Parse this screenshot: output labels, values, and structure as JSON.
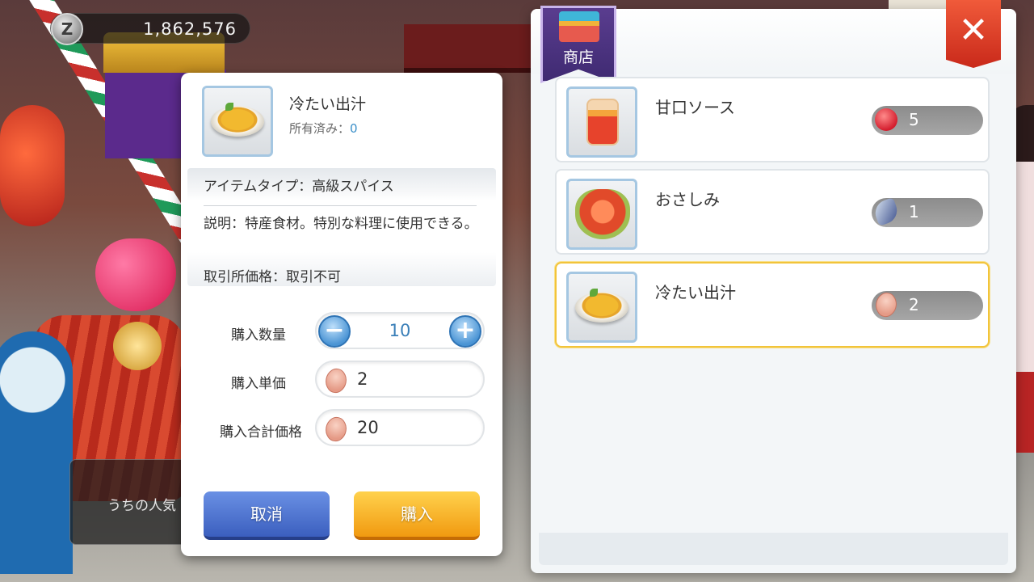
{
  "currency": {
    "icon_letter": "Z",
    "icon": "zeny-coin-icon",
    "amount": "1,862,576"
  },
  "chat": {
    "text": "うちの人気"
  },
  "dialog": {
    "item_name": "冷たい出汁",
    "owned_label": "所有済み：",
    "owned_count": "0",
    "item_type": "アイテムタイプ：高級スパイス",
    "description": "説明：特産食材。特別な料理に使用できる。",
    "exchange_price": "取引所価格：取引不可",
    "quantity_label": "購入数量",
    "quantity": "10",
    "minus_symbol": "−",
    "plus_symbol": "+",
    "unit_price_label": "購入単価",
    "unit_price": "2",
    "total_price_label": "購入合計価格",
    "total_price": "20",
    "price_icon": "meat-icon",
    "cancel_label": "取消",
    "buy_label": "購入"
  },
  "shop": {
    "banner_label": "商店",
    "close_symbol": "✕",
    "items": [
      {
        "name": "甘口ソース",
        "cost": "5",
        "cost_icon": "apple-icon",
        "selected": false
      },
      {
        "name": "おさしみ",
        "cost": "1",
        "cost_icon": "fish-icon",
        "selected": false
      },
      {
        "name": "冷たい出汁",
        "cost": "2",
        "cost_icon": "meat-icon",
        "selected": true
      }
    ]
  },
  "colors": {
    "accent_blue": "#3a8fc9",
    "buy_orange": "#f19a10",
    "cancel_blue": "#3b5fbf",
    "selected_border": "#f2c43a",
    "close_red": "#c9291a",
    "banner_purple": "#3f2a72"
  }
}
